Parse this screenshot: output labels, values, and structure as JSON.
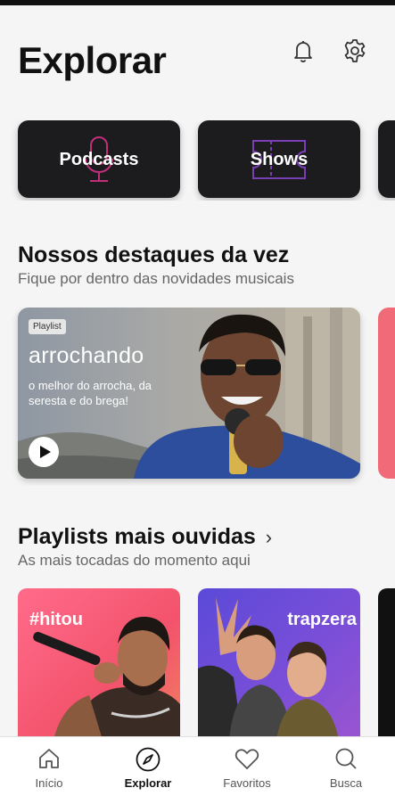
{
  "header": {
    "title": "Explorar"
  },
  "categories": [
    {
      "label": "Podcasts"
    },
    {
      "label": "Shows"
    }
  ],
  "featured": {
    "title": "Nossos destaques da vez",
    "subtitle": "Fique por dentro das novidades musicais",
    "card": {
      "badge": "Playlist",
      "title": "arrochando",
      "description": "o melhor do arrocha, da seresta e do brega!"
    }
  },
  "playlists": {
    "title": "Playlists mais ouvidas",
    "subtitle": "As mais tocadas do momento aqui",
    "items": [
      {
        "title": "#hitou"
      },
      {
        "title": "trapzera"
      }
    ]
  },
  "nav": {
    "items": [
      {
        "label": "Início",
        "icon": "home-icon"
      },
      {
        "label": "Explorar",
        "icon": "compass-icon",
        "active": true
      },
      {
        "label": "Favoritos",
        "icon": "heart-icon"
      },
      {
        "label": "Busca",
        "icon": "search-icon"
      }
    ]
  },
  "colors": {
    "accent": "#f06a78",
    "card_dark": "#1c1c1f",
    "podcast_accent": "#c0307a",
    "shows_accent": "#7a3fb5"
  }
}
